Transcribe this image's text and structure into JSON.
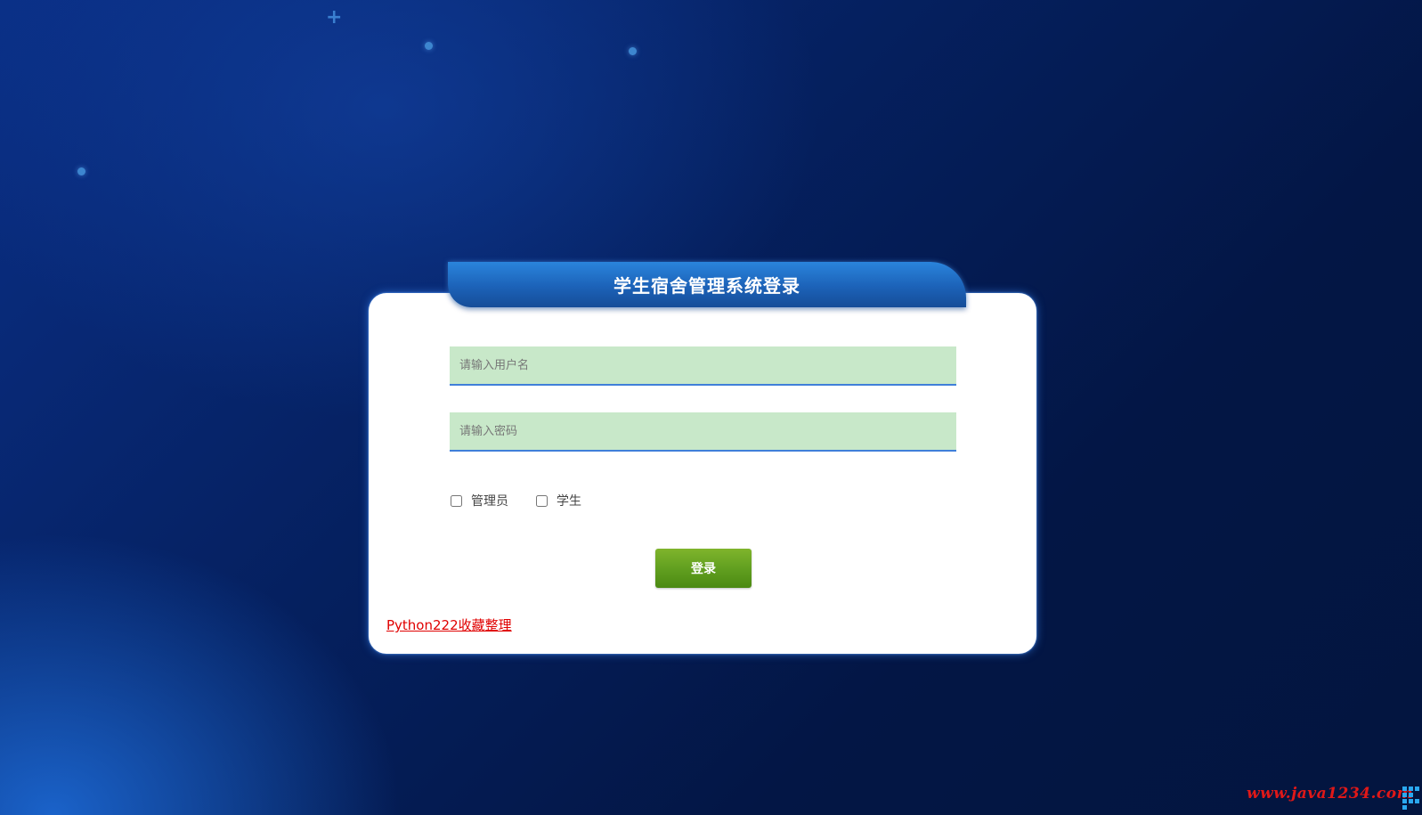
{
  "login": {
    "title": "学生宿舍管理系统登录",
    "username_placeholder": "请输入用户名",
    "password_placeholder": "请输入密码",
    "roles": [
      "管理员",
      "学生"
    ],
    "submit_label": "登录",
    "credit_link": "Python222收藏整理"
  },
  "watermark": "www.java1234.com",
  "colors": {
    "background": "#05205f",
    "title_bar": "#1c62b8",
    "input_fill": "#c8e8c9",
    "button": "#62a020",
    "link": "#e00000"
  }
}
